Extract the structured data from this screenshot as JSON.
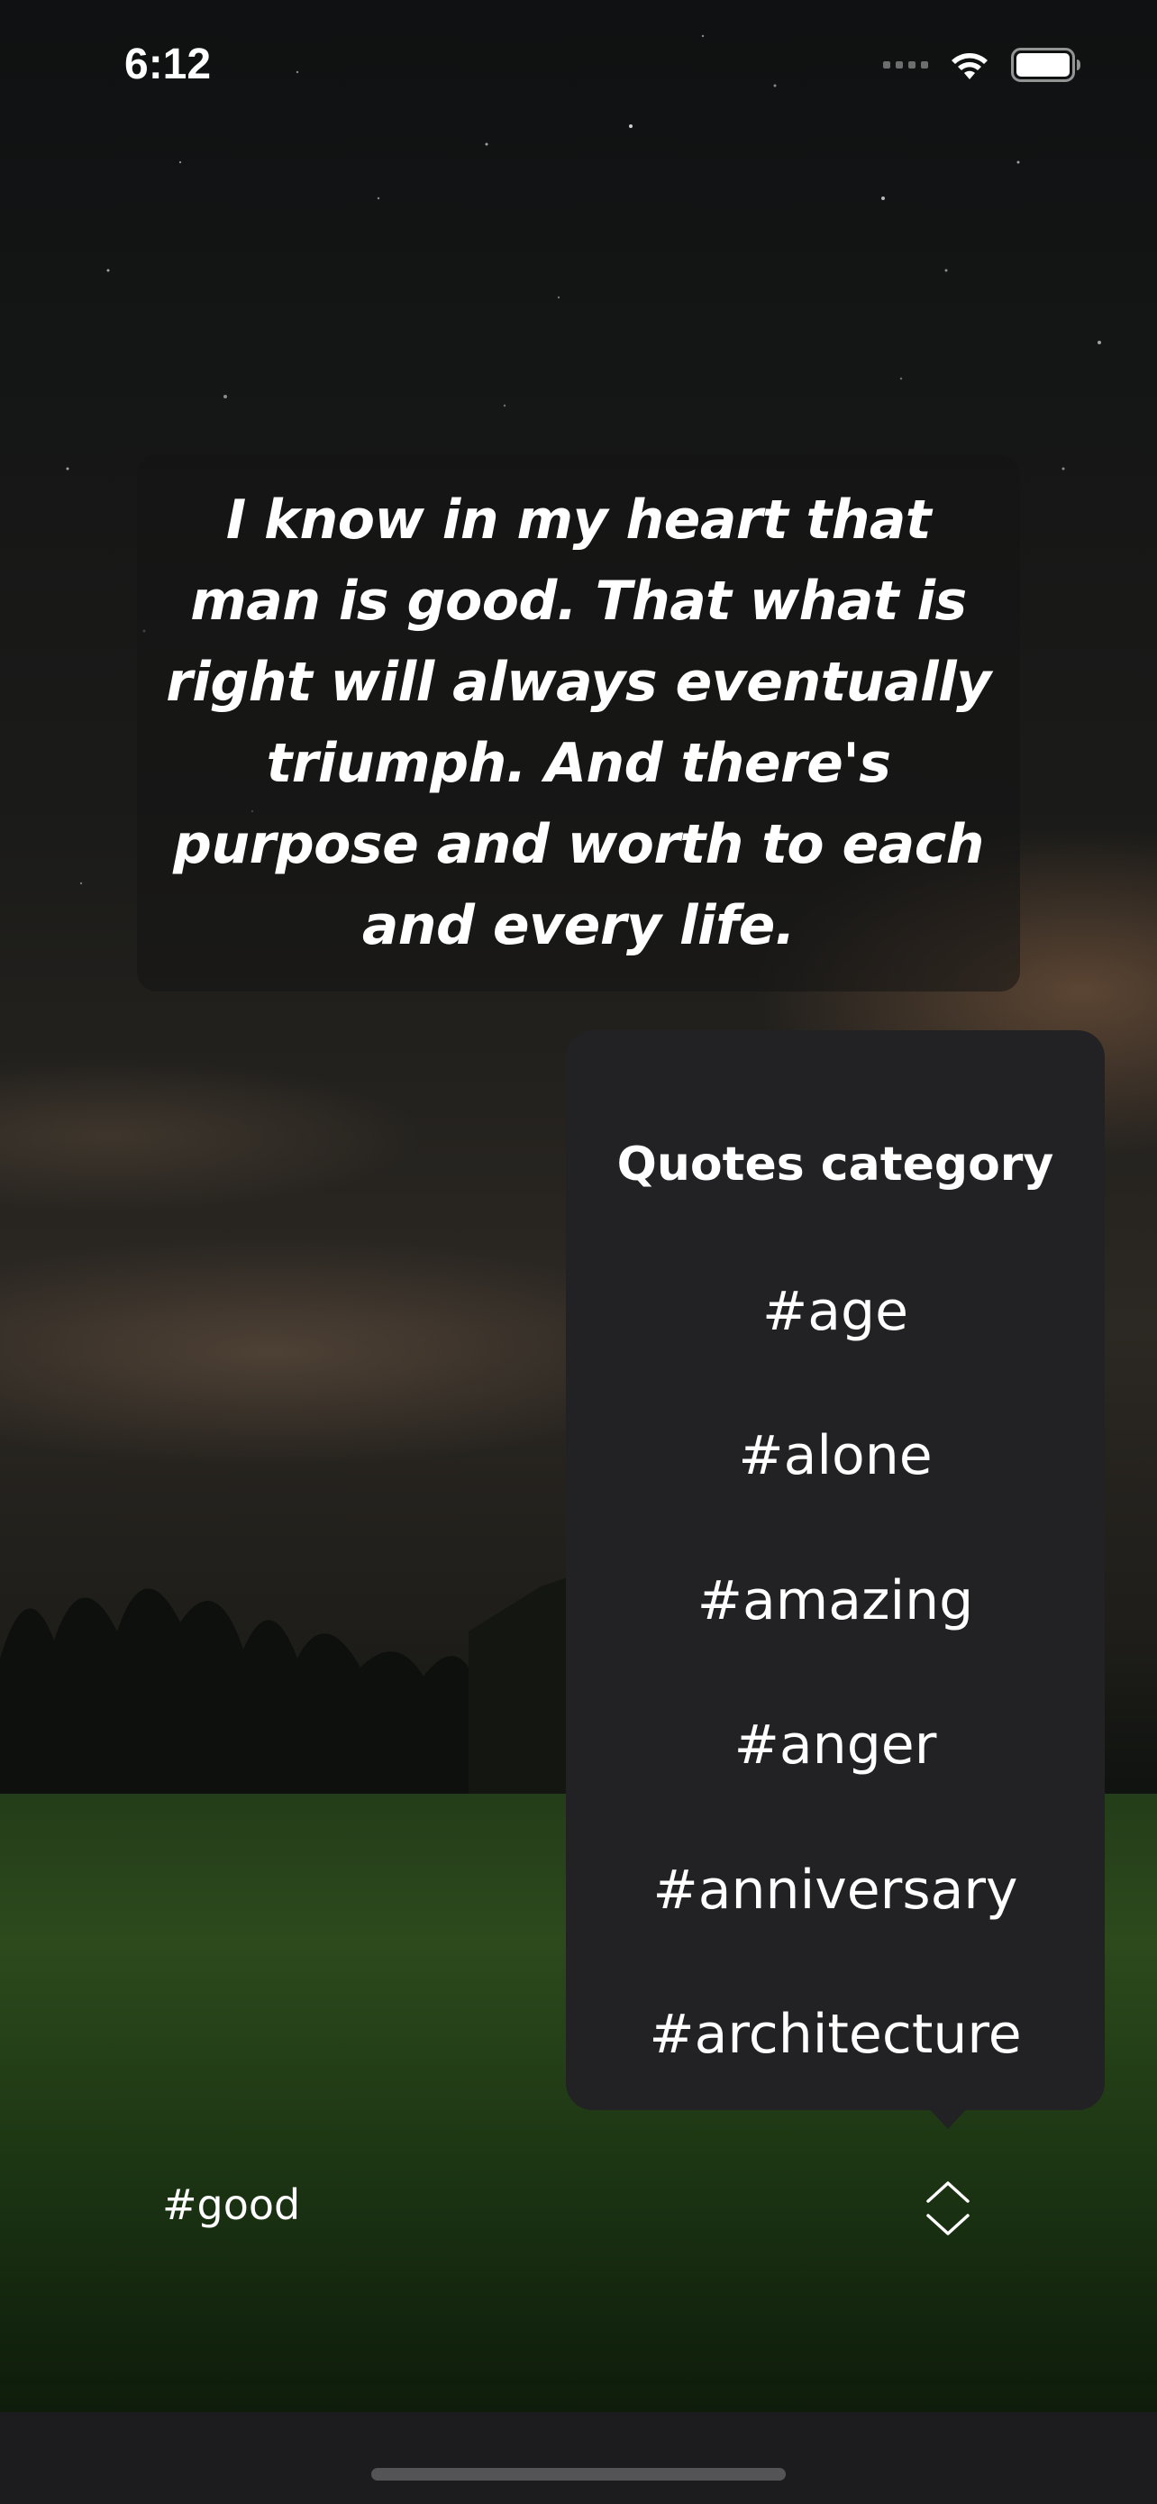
{
  "status_bar": {
    "time": "6:12"
  },
  "quote": {
    "text": "I know in my heart that man is good. That what is right will always eventually triumph. And there's purpose and worth to each and every life."
  },
  "category_menu": {
    "title": "Quotes category",
    "items": [
      {
        "label": "#age"
      },
      {
        "label": "#alone"
      },
      {
        "label": "#amazing"
      },
      {
        "label": "#anger"
      },
      {
        "label": "#anniversary"
      },
      {
        "label": "#architecture"
      }
    ]
  },
  "footer": {
    "current_category": "#good"
  },
  "icons": {
    "wifi": "wifi-icon",
    "battery": "battery-icon",
    "chevron": "chevron-up-down-icon"
  },
  "colors": {
    "popover_bg": "#222124",
    "text": "#ffffff",
    "home_bar_bg": "#1c1c1e"
  }
}
